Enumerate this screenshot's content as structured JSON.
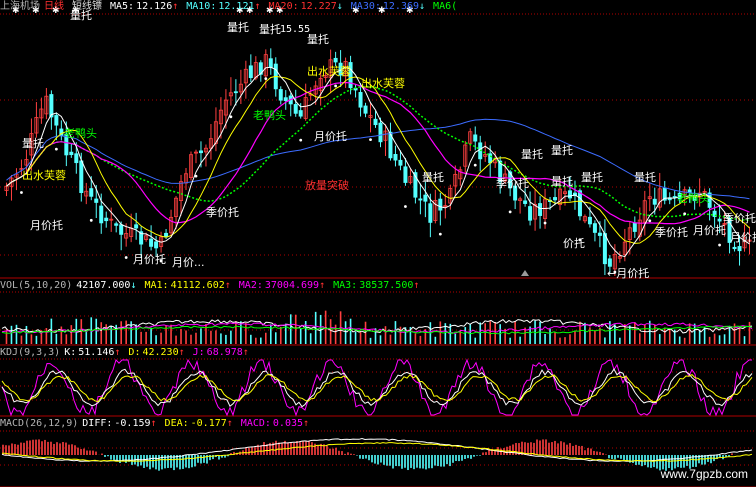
{
  "colors": {
    "background": "#000000",
    "up": "#ff4040",
    "down": "#54ffff",
    "ma5": "#ffffff",
    "ma10": "#ffff00",
    "ma20": "#ff00ff",
    "ma30": "#00ff00",
    "ma60": "#3c6cff",
    "frame": "#b00000",
    "label_white": "#ffffff",
    "label_yellow": "#ffff00",
    "label_green": "#00ff00",
    "label_red": "#ff3030",
    "kdj_k": "#ffffff",
    "kdj_d": "#ffff00",
    "kdj_j": "#ff00ff",
    "macd_pos": "#ff4040",
    "macd_neg": "#54ffff"
  },
  "price_panel": {
    "stock_name": "上海机场",
    "period": "日线",
    "indicator_name": "短线镖",
    "ma5_label": "MA5:",
    "ma5_value": "12.126",
    "ma5_dir": "↑",
    "ma10_label": "MA10:",
    "ma10_value": "12.121",
    "ma10_dir": "↑",
    "ma20_label": "MA20:",
    "ma20_value": "12.227",
    "ma20_dir": "↓",
    "ma30_label": "MA30:",
    "ma30_value": "12.369",
    "ma30_dir": "↓",
    "ma60_label": "MA6("
  },
  "vol_panel": {
    "name": "VOL(5,10,20)",
    "vol_value": "42107.000",
    "vol_dir": "↓",
    "ma1_label": "MA1:",
    "ma1_value": "41112.602",
    "ma1_dir": "↑",
    "ma2_label": "MA2:",
    "ma2_value": "37004.699",
    "ma2_dir": "↑",
    "ma3_label": "MA3:",
    "ma3_value": "38537.500",
    "ma3_dir": "↑"
  },
  "kdj_panel": {
    "name": "KDJ(9,3,3)",
    "k_label": "K:",
    "k_value": "51.146",
    "k_dir": "↑",
    "d_label": "D:",
    "d_value": "42.230",
    "d_dir": "↑",
    "j_label": "J:",
    "j_value": "68.978",
    "j_dir": "↑"
  },
  "macd_panel": {
    "name": "MACD(26,12,9)",
    "diff_label": "DIFF:",
    "diff_value": "-0.159",
    "diff_dir": "↑",
    "dea_label": "DEA:",
    "dea_value": "-0.177",
    "dea_dir": "↑",
    "macd_label": "MACD:",
    "macd_value": "0.035",
    "macd_dir": "↑"
  },
  "price_level_text": "15.55",
  "annotations": [
    {
      "text": "量托",
      "color": "#ffffff"
    },
    {
      "text": "量托",
      "color": "#ffffff"
    },
    {
      "text": "量托",
      "color": "#ffffff"
    },
    {
      "text": "量托",
      "color": "#ffffff"
    },
    {
      "text": "量托",
      "color": "#ffffff"
    },
    {
      "text": "量托",
      "color": "#ffffff"
    },
    {
      "text": "量托",
      "color": "#ffffff"
    },
    {
      "text": "量托",
      "color": "#ffffff"
    },
    {
      "text": "量托",
      "color": "#ffffff"
    },
    {
      "text": "量托",
      "color": "#ffffff"
    },
    {
      "text": "量托",
      "color": "#ffffff"
    },
    {
      "text": "出水芙蓉",
      "color": "#ffff00"
    },
    {
      "text": "出水芙蓉",
      "color": "#ffff00"
    },
    {
      "text": "出水芙蓉",
      "color": "#ffff00"
    },
    {
      "text": "老鸭头",
      "color": "#00ff00"
    },
    {
      "text": "老鸭头",
      "color": "#00ff00"
    },
    {
      "text": "老鸭头",
      "color": "#00ff00"
    },
    {
      "text": "月价托",
      "color": "#ffffff"
    },
    {
      "text": "月价托",
      "color": "#ffffff"
    },
    {
      "text": "月价...",
      "color": "#ffffff"
    },
    {
      "text": "月价托",
      "color": "#ffffff"
    },
    {
      "text": "←月价托",
      "color": "#ffffff"
    },
    {
      "text": "月价托",
      "color": "#ffffff"
    },
    {
      "text": "月价托",
      "color": "#ffffff"
    },
    {
      "text": "季价托",
      "color": "#ffffff"
    },
    {
      "text": "季价托",
      "color": "#ffffff"
    },
    {
      "text": "季价托",
      "color": "#ffffff"
    },
    {
      "text": "季价托",
      "color": "#ffffff"
    },
    {
      "text": "价托",
      "color": "#ffffff"
    },
    {
      "text": "放量突破",
      "color": "#ff3030"
    }
  ],
  "watermark": "www.7gpzb.com",
  "chart_data": [
    {
      "type": "candlestick",
      "title": "上海机场 日线 短线镖",
      "price_marks": [
        15.55
      ],
      "ma_series": [
        {
          "name": "MA5",
          "last": 12.126
        },
        {
          "name": "MA10",
          "last": 12.121
        },
        {
          "name": "MA20",
          "last": 12.227
        },
        {
          "name": "MA30",
          "last": 12.369
        }
      ]
    },
    {
      "type": "bar",
      "title": "VOL(5,10,20)",
      "series": [
        {
          "name": "VOL",
          "last": 42107.0
        },
        {
          "name": "MA1",
          "last": 41112.602
        },
        {
          "name": "MA2",
          "last": 37004.699
        },
        {
          "name": "MA3",
          "last": 38537.5
        }
      ]
    },
    {
      "type": "line",
      "title": "KDJ(9,3,3)",
      "series": [
        {
          "name": "K",
          "last": 51.146
        },
        {
          "name": "D",
          "last": 42.23
        },
        {
          "name": "J",
          "last": 68.978
        }
      ]
    },
    {
      "type": "bar",
      "title": "MACD(26,12,9)",
      "series": [
        {
          "name": "DIFF",
          "last": -0.159
        },
        {
          "name": "DEA",
          "last": -0.177
        },
        {
          "name": "MACD",
          "last": 0.035
        }
      ]
    }
  ]
}
